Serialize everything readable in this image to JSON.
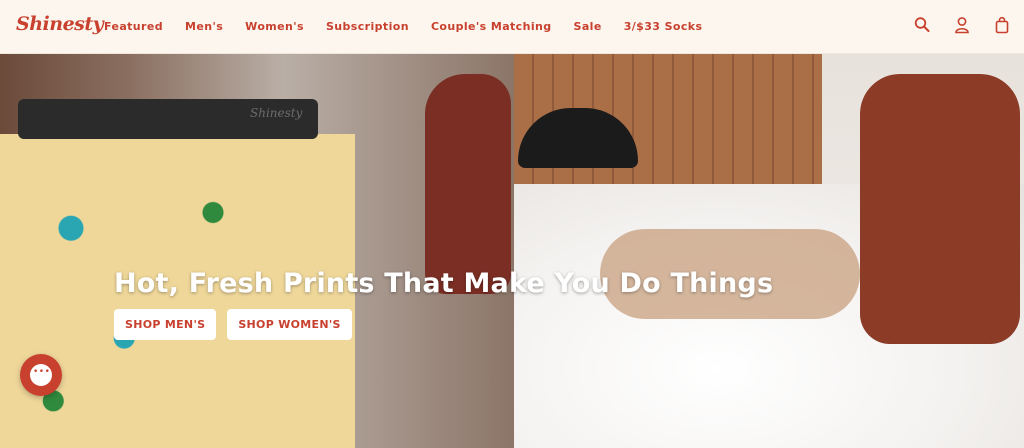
{
  "header": {
    "logo_text": "Shinesty",
    "nav": [
      {
        "label": "Featured"
      },
      {
        "label": "Men's"
      },
      {
        "label": "Women's"
      },
      {
        "label": "Subscription"
      },
      {
        "label": "Couple's Matching"
      },
      {
        "label": "Sale"
      },
      {
        "label": "3/$33 Socks"
      }
    ],
    "icons": [
      "search-icon",
      "account-icon",
      "bag-icon"
    ]
  },
  "hero": {
    "headline": "Hot, Fresh Prints That Make You Do Things",
    "buttons": [
      {
        "label": "SHOP MEN'S"
      },
      {
        "label": "SHOP WOMEN'S"
      }
    ],
    "waistband_text": "Shinesty"
  },
  "colors": {
    "brand": "#c8402e",
    "header_bg": "#fdf6ee",
    "button_bg": "#ffffff"
  }
}
